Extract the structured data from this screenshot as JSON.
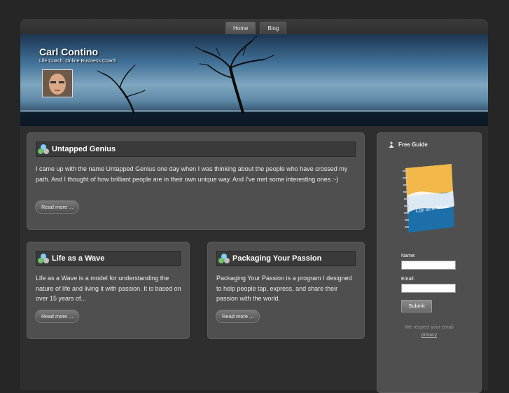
{
  "nav": {
    "items": [
      {
        "label": "Home"
      },
      {
        "label": "Blog"
      }
    ]
  },
  "header": {
    "title": "Carl Contino",
    "tagline": "Life Coach. Online Business Coach"
  },
  "cards": {
    "untapped": {
      "title": "Untapped Genius",
      "text": "I came up with the name Untapped Genius one day when I was thinking about the people who have crossed my path. And I thought of how brilliant people are in their own unique way. And I've met some interesting ones :-)",
      "button": "Read more ..."
    },
    "wave": {
      "title": "Life as a Wave",
      "text": "Life as a Wave is a model for understanding the nature of life and living it with passion. It is based on over 15 years of...",
      "button": "Read more ..."
    },
    "passion": {
      "title": "Packaging Your Passion",
      "text": "Packaging Your Passion is a program I designed to help people tap, express, and share their passion with the world.",
      "button": "Read more ..."
    }
  },
  "sidebar": {
    "title": "Free Guide",
    "book_cover_title": "Life as a Wave",
    "name_label": "Name:",
    "email_label": "Email:",
    "submit": "Submit",
    "privacy_text": "We respect your email",
    "privacy_link": "privacy"
  },
  "colors": {
    "accent_blue": "#3f6f96",
    "card_bg": "#4f4f4f"
  }
}
